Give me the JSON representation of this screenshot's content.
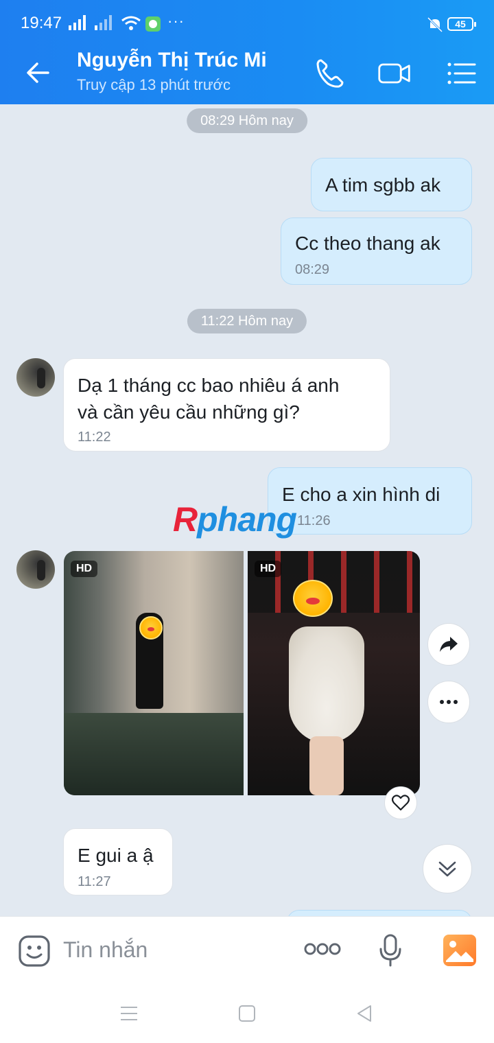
{
  "status_bar": {
    "time": "19:47",
    "battery": "45",
    "dots": "···"
  },
  "header": {
    "contact_name": "Nguyễn Thị Trúc Mi",
    "last_seen": "Truy cập 13 phút trước"
  },
  "chat": {
    "time_pill_1": "08:29 Hôm nay",
    "time_pill_2": "11:22 Hôm nay",
    "messages": [
      {
        "direction": "out",
        "text": "A tim sgbb ak"
      },
      {
        "direction": "out",
        "text": "Cc theo thang ak",
        "time": "08:29"
      },
      {
        "direction": "in",
        "text_line1": "Dạ 1 tháng cc bao nhiêu á anh",
        "text_line2": "và cần yêu cầu những gì?",
        "time": "11:22"
      },
      {
        "direction": "out",
        "text": "E cho a xin hình di",
        "time": "11:26"
      },
      {
        "direction": "in",
        "type": "photos",
        "badges": [
          "HD",
          "HD"
        ]
      },
      {
        "direction": "in",
        "text": "E gui a ậ",
        "time": "11:27"
      }
    ],
    "watermark": {
      "part1": "R",
      "part2": "phang"
    }
  },
  "composer": {
    "placeholder": "Tin nhắn"
  },
  "icons": [
    "back-arrow-icon",
    "phone-icon",
    "video-call-icon",
    "menu-list-icon",
    "share-icon",
    "more-icon",
    "heart-icon",
    "scroll-down-icon",
    "emoji-icon",
    "more-options-icon",
    "microphone-icon",
    "image-icon",
    "recent-apps-icon",
    "home-icon",
    "back-nav-icon"
  ],
  "colors": {
    "header": "#1a8cf3",
    "outgoing_bubble": "#d5edfd",
    "incoming_bubble": "#ffffff",
    "background": "#e2e9f1"
  }
}
